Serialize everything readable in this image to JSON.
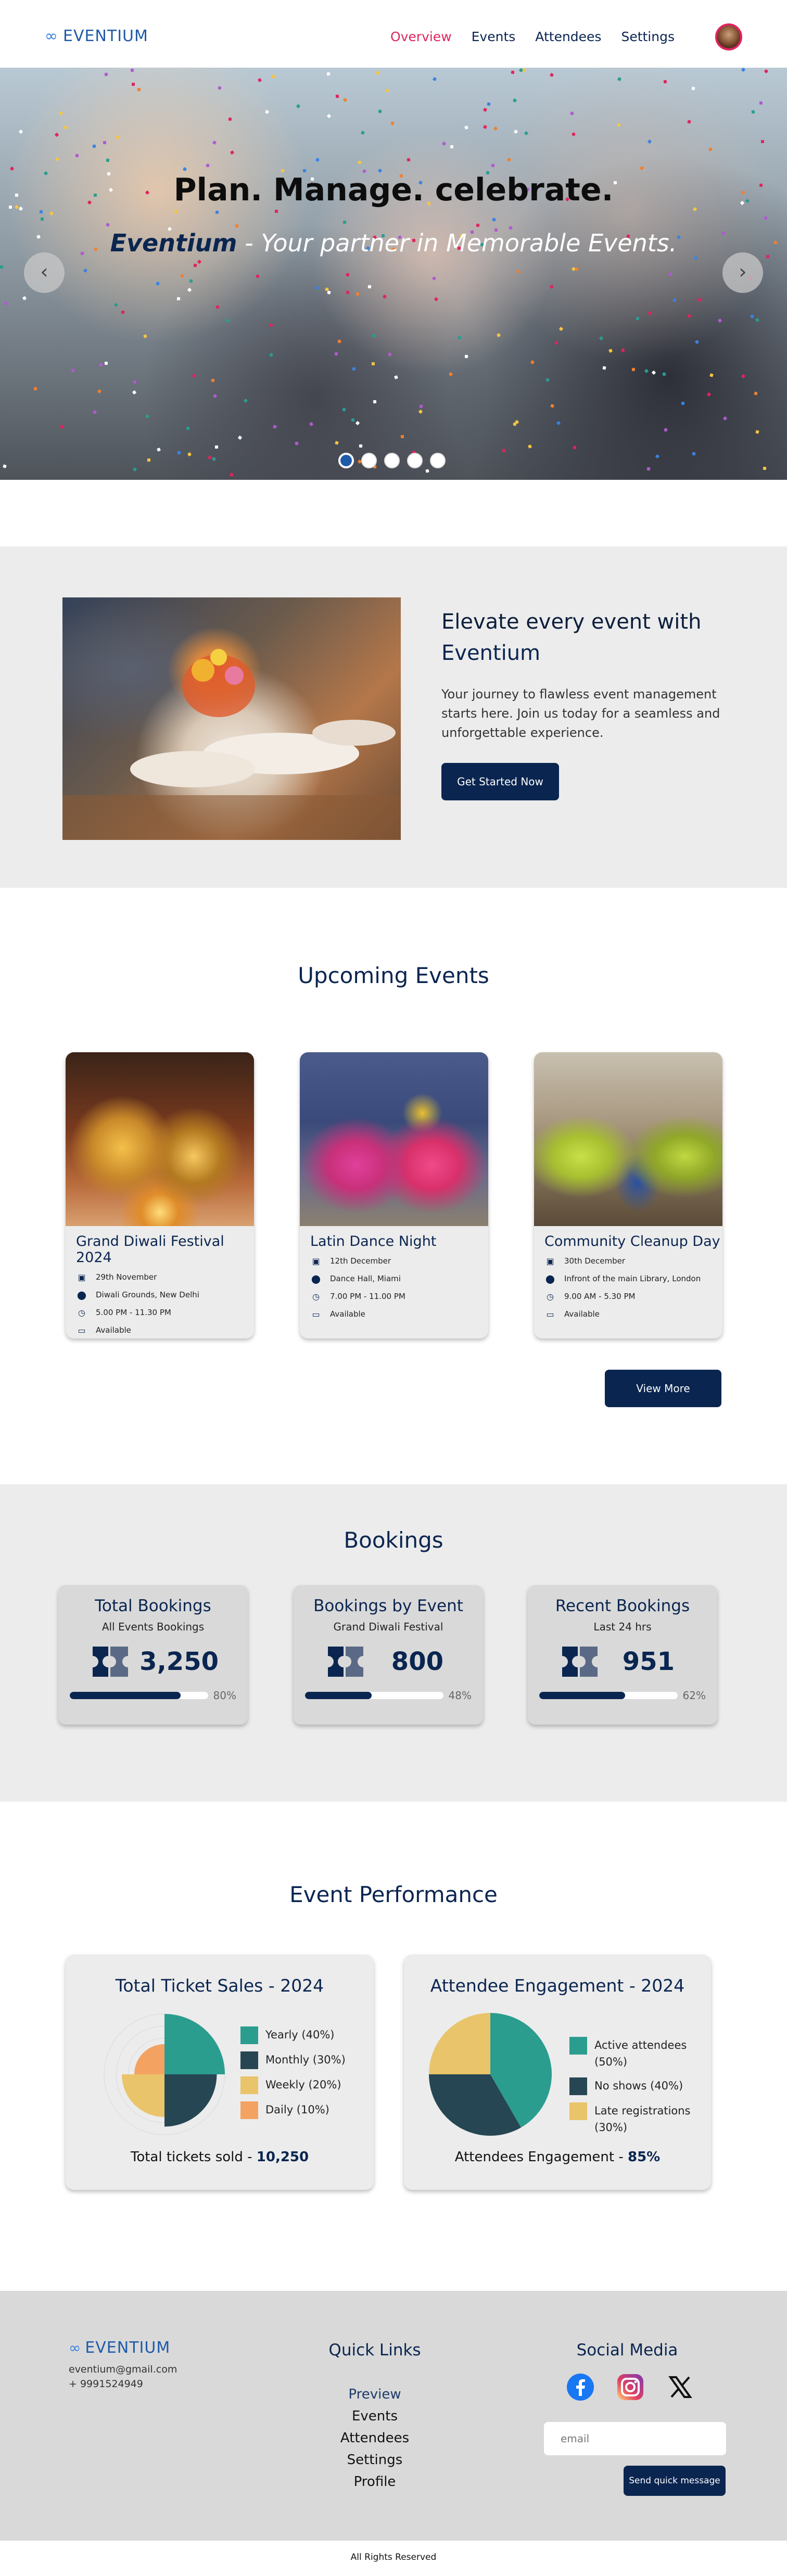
{
  "nav": {
    "brand": "EVENTIUM",
    "links": [
      "Overview",
      "Events",
      "Attendees",
      "Settings"
    ],
    "active": "Overview"
  },
  "hero": {
    "title": "Plan. Manage. celebrate.",
    "brand": "Eventium",
    "tagline": " - Your partner in Memorable Events.",
    "slide_count": 5,
    "active_slide": 1
  },
  "promo": {
    "heading_line1": "Elevate every event with",
    "heading_brand": "Eventium",
    "text": "Your journey to flawless event management starts here. Join us today for a seamless and unforgettable experience.",
    "button": "Get Started Now"
  },
  "events": {
    "title": "Upcoming Events",
    "items": [
      {
        "name": "Grand Diwali Festival 2024",
        "date": "29th November",
        "location": "Diwali Grounds, New Delhi",
        "time": "5.00 PM - 11.30 PM",
        "status": "Available"
      },
      {
        "name": "Latin Dance Night",
        "date": "12th December",
        "location": "Dance Hall, Miami",
        "time": "7.00 PM - 11.00 PM",
        "status": "Available"
      },
      {
        "name": "Community Cleanup Day",
        "date": "30th December",
        "location": "Infront of the main Library, London",
        "time": "9.00 AM - 5.30 PM",
        "status": "Available"
      }
    ],
    "view_more": "View More"
  },
  "bookings": {
    "title": "Bookings",
    "cards": [
      {
        "title": "Total Bookings",
        "subtitle": "All Events Bookings",
        "value": "3,250",
        "progress": 80,
        "progress_label": "80%"
      },
      {
        "title": "Bookings by Event",
        "subtitle": "Grand Diwali Festival",
        "value": "800",
        "progress": 48,
        "progress_label": "48%"
      },
      {
        "title": "Recent Bookings",
        "subtitle": "Last 24 hrs",
        "value": "951",
        "progress": 62,
        "progress_label": "62%"
      }
    ]
  },
  "performance": {
    "title": "Event Performance",
    "ticket_footer_label": "Total tickets sold - ",
    "ticket_footer_value": "10,250",
    "engagement_footer_label": "Attendees Engagement - ",
    "engagement_footer_value": "85%"
  },
  "chart_data": [
    {
      "type": "pie",
      "title": "Total Ticket Sales - 2024",
      "style": "polar-area",
      "categories": [
        "Yearly (40%)",
        "Monthly (30%)",
        "Weekly (20%)",
        "Daily (10%)"
      ],
      "values": [
        40,
        30,
        20,
        10
      ],
      "colors": [
        "#2a9d8f",
        "#264653",
        "#e9c46a",
        "#f4a261"
      ]
    },
    {
      "type": "pie",
      "title": "Attendee Engagement - 2024",
      "categories": [
        "Active attendees (50%)",
        "No shows (40%)",
        "Late registrations (30%)"
      ],
      "values": [
        50,
        40,
        30
      ],
      "colors": [
        "#2a9d8f",
        "#264653",
        "#e9c46a"
      ]
    }
  ],
  "footer": {
    "brand": "EVENTIUM",
    "email": "eventium@gmail.com",
    "phone": "+ 9991524949",
    "quick_links_title": "Quick Links",
    "quick_links": [
      "Preview",
      "Events",
      "Attendees",
      "Settings",
      "Profile"
    ],
    "social_title": "Social Media",
    "social_icons": [
      "facebook-icon",
      "instagram-icon",
      "x-icon"
    ],
    "email_placeholder": "email",
    "send_button": "Send quick message",
    "rights": "All Rights Reserved"
  },
  "colors": {
    "navy": "#0a2550",
    "accent_pink": "#e0245e",
    "brand_blue": "#1e5aa8",
    "section_gray": "#ececec"
  }
}
